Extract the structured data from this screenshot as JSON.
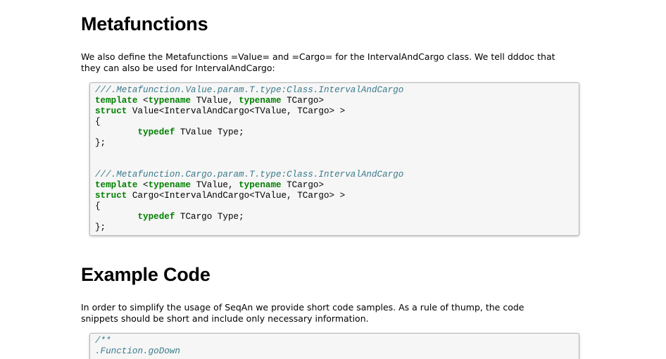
{
  "sections": [
    {
      "heading": "Metafunctions",
      "paragraph_lines": [
        "We also define the Metafunctions =Value= and =Cargo= for the IntervalAndCargo class. We tell dddoc that",
        "they can also be used for IntervalAndCargo:"
      ],
      "code_lines": [
        [
          {
            "t": "///.Metafunction.Value.param.T.type:Class.IntervalAndCargo",
            "c": "cmt"
          }
        ],
        [
          {
            "t": "template",
            "c": "kw"
          },
          {
            "t": " <"
          },
          {
            "t": "typename",
            "c": "kw"
          },
          {
            "t": " TValue, "
          },
          {
            "t": "typename",
            "c": "kw"
          },
          {
            "t": " TCargo>"
          }
        ],
        [
          {
            "t": "struct",
            "c": "kw"
          },
          {
            "t": " Value<IntervalAndCargo<TValue, TCargo> >"
          }
        ],
        [
          {
            "t": "{"
          }
        ],
        [
          {
            "t": "        "
          },
          {
            "t": "typedef",
            "c": "kw"
          },
          {
            "t": " TValue Type;"
          }
        ],
        [
          {
            "t": "};"
          }
        ],
        [
          {
            "t": ""
          }
        ],
        [
          {
            "t": ""
          }
        ],
        [
          {
            "t": "///.Metafunction.Cargo.param.T.type:Class.IntervalAndCargo",
            "c": "cmt"
          }
        ],
        [
          {
            "t": "template",
            "c": "kw"
          },
          {
            "t": " <"
          },
          {
            "t": "typename",
            "c": "kw"
          },
          {
            "t": " TValue, "
          },
          {
            "t": "typename",
            "c": "kw"
          },
          {
            "t": " TCargo>"
          }
        ],
        [
          {
            "t": "struct",
            "c": "kw"
          },
          {
            "t": " Cargo<IntervalAndCargo<TValue, TCargo> >"
          }
        ],
        [
          {
            "t": "{"
          }
        ],
        [
          {
            "t": "        "
          },
          {
            "t": "typedef",
            "c": "kw"
          },
          {
            "t": " TCargo Type;"
          }
        ],
        [
          {
            "t": "};"
          }
        ]
      ]
    },
    {
      "heading": "Example Code",
      "paragraph_lines": [
        "In order to simplify the usage of SeqAn we provide short code samples. As a rule of thump, the code",
        "snippets should be short and include only necessary information."
      ],
      "code_lines": [
        [
          {
            "t": "/**",
            "c": "cmt"
          }
        ],
        [
          {
            "t": ".Function.goDown",
            "c": "cmt"
          }
        ]
      ]
    }
  ]
}
